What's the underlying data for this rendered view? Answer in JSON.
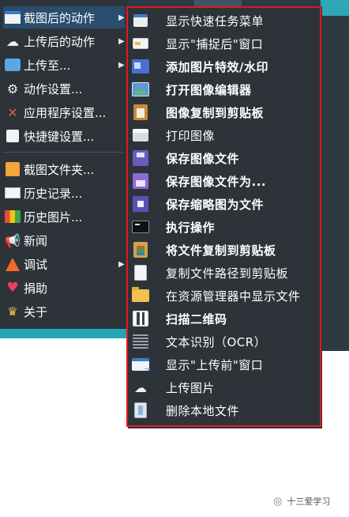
{
  "main_menu": {
    "items": [
      {
        "label": "截图后的动作",
        "icon": "screenshot-action-icon",
        "has_submenu": true,
        "highlighted": true
      },
      {
        "label": "上传后的动作",
        "icon": "upload-action-icon",
        "has_submenu": true
      },
      {
        "label": "上传至...",
        "icon": "upload-to-icon",
        "has_submenu": true
      },
      {
        "label": "动作设置...",
        "icon": "gear-icon"
      },
      {
        "label": "应用程序设置...",
        "icon": "tools-icon"
      },
      {
        "label": "快捷键设置...",
        "icon": "hotkey-icon"
      },
      {
        "label": "截图文件夹...",
        "icon": "folder-icon"
      },
      {
        "label": "历史记录...",
        "icon": "history-icon"
      },
      {
        "label": "历史图片...",
        "icon": "image-history-icon"
      },
      {
        "label": "新闻",
        "icon": "megaphone-icon"
      },
      {
        "label": "调试",
        "icon": "debug-cone-icon",
        "has_submenu": true
      },
      {
        "label": "捐助",
        "icon": "heart-icon"
      },
      {
        "label": "关于",
        "icon": "crown-icon"
      }
    ]
  },
  "sub_menu": {
    "items": [
      {
        "label": "显示快速任务菜单",
        "icon": "quick-task-menu-icon",
        "checked": false
      },
      {
        "label": "显示\"捕捉后\"窗口",
        "icon": "after-capture-window-icon",
        "checked": false
      },
      {
        "label": "添加图片特效/水印",
        "icon": "image-effects-icon",
        "checked": true
      },
      {
        "label": "打开图像编辑器",
        "icon": "image-editor-icon",
        "checked": true
      },
      {
        "label": "图像复制到剪贴板",
        "icon": "copy-image-clipboard-icon",
        "checked": true
      },
      {
        "label": "打印图像",
        "icon": "printer-icon",
        "checked": false
      },
      {
        "label": "保存图像文件",
        "icon": "save-icon",
        "checked": true
      },
      {
        "label": "保存图像文件为...",
        "icon": "save-as-icon",
        "checked": true
      },
      {
        "label": "保存缩略图为文件",
        "icon": "save-thumbnail-icon",
        "checked": true
      },
      {
        "label": "执行操作",
        "icon": "terminal-icon",
        "checked": true
      },
      {
        "label": "将文件复制到剪贴板",
        "icon": "copy-file-clipboard-icon",
        "checked": true
      },
      {
        "label": "复制文件路径到剪贴板",
        "icon": "copy-path-icon",
        "checked": false
      },
      {
        "label": "在资源管理器中显示文件",
        "icon": "explorer-folder-icon",
        "checked": false
      },
      {
        "label": "扫描二维码",
        "icon": "qr-code-icon",
        "checked": true
      },
      {
        "label": "文本识别（OCR）",
        "icon": "ocr-text-icon",
        "checked": false
      },
      {
        "label": "显示\"上传前\"窗口",
        "icon": "before-upload-window-icon",
        "checked": false
      },
      {
        "label": "上传图片",
        "icon": "cloud-upload-icon",
        "checked": false
      },
      {
        "label": "删除本地文件",
        "icon": "delete-file-icon",
        "checked": false
      }
    ]
  },
  "watermark": {
    "text": "十三爱学习",
    "icon": "wechat-icon"
  },
  "colors": {
    "menu_bg": "#2d3339",
    "highlight": "#2a4d6e",
    "frame": "#e0191f",
    "teal": "#22a6b3"
  }
}
